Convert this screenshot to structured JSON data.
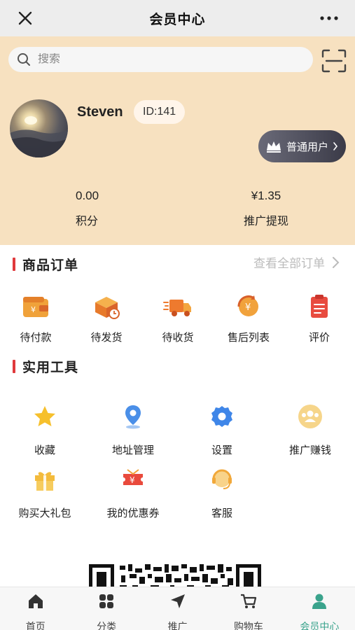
{
  "topbar": {
    "title": "会员中心"
  },
  "search": {
    "placeholder": "搜索"
  },
  "user": {
    "name": "Steven",
    "id_label": "ID:141",
    "level_label": "普通用户"
  },
  "stats": [
    {
      "value": "0.00",
      "label": "积分"
    },
    {
      "value": "¥1.35",
      "label": "推广提现"
    }
  ],
  "orders": {
    "title": "商品订单",
    "view_all": "查看全部订单",
    "items": [
      {
        "label": "待付款",
        "icon": "wallet-icon"
      },
      {
        "label": "待发货",
        "icon": "package-icon"
      },
      {
        "label": "待收货",
        "icon": "truck-icon"
      },
      {
        "label": "售后列表",
        "icon": "refund-icon"
      },
      {
        "label": "评价",
        "icon": "clipboard-icon"
      }
    ]
  },
  "tools": {
    "title": "实用工具",
    "items": [
      {
        "label": "收藏",
        "icon": "star-icon"
      },
      {
        "label": "地址管理",
        "icon": "location-icon"
      },
      {
        "label": "设置",
        "icon": "gear-icon"
      },
      {
        "label": "推广赚钱",
        "icon": "group-icon"
      },
      {
        "label": "购买大礼包",
        "icon": "gift-icon"
      },
      {
        "label": "我的优惠券",
        "icon": "coupon-icon"
      },
      {
        "label": "客服",
        "icon": "headset-icon"
      }
    ]
  },
  "tabbar": {
    "items": [
      {
        "label": "首页",
        "icon": "home-icon"
      },
      {
        "label": "分类",
        "icon": "category-icon"
      },
      {
        "label": "推广",
        "icon": "send-icon"
      },
      {
        "label": "购物车",
        "icon": "cart-icon"
      },
      {
        "label": "会员中心",
        "icon": "member-icon",
        "active": true
      }
    ]
  },
  "colors": {
    "accent": "#3aa38c",
    "header_bg": "#f7e1c0",
    "section_bar": "#e0393c"
  }
}
